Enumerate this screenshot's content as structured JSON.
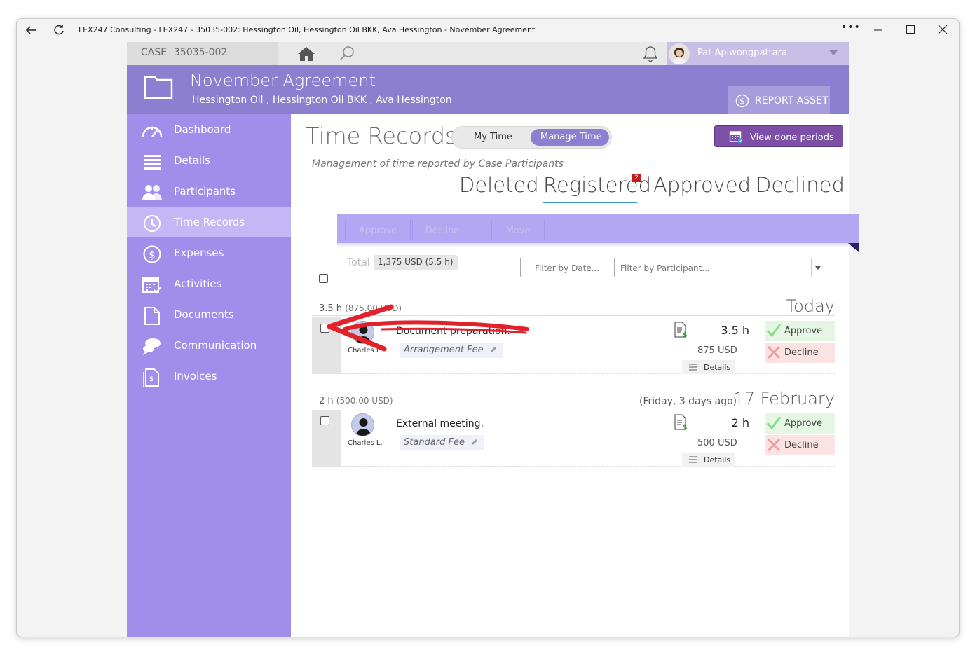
{
  "window": {
    "title": "LEX247 Consulting - LEX247 - 35035-002: Hessington Oil, Hessington Oil BKK, Ava Hessington - November Agreement",
    "more_label": "•••"
  },
  "topbar": {
    "case_label": "CASE",
    "case_number": "35035-002",
    "user_name": "Pat Apiwongpattara"
  },
  "header": {
    "title": "November Agreement",
    "subtitle": "Hessington Oil ,  Hessington Oil BKK ,  Ava Hessington",
    "report_label": "REPORT ASSET"
  },
  "sidebar": {
    "items": [
      {
        "label": "Dashboard",
        "icon": "gauge-icon"
      },
      {
        "label": "Details",
        "icon": "list-icon"
      },
      {
        "label": "Participants",
        "icon": "people-icon"
      },
      {
        "label": "Time Records",
        "icon": "clock-icon",
        "active": true
      },
      {
        "label": "Expenses",
        "icon": "dollar-circle-icon"
      },
      {
        "label": "Activities",
        "icon": "calendar-icon"
      },
      {
        "label": "Documents",
        "icon": "document-icon"
      },
      {
        "label": "Communication",
        "icon": "chat-bubble-icon"
      },
      {
        "label": "Invoices",
        "icon": "invoice-icon"
      }
    ]
  },
  "main": {
    "title": "Time Records",
    "toggle": {
      "my_time": "My Time",
      "manage_time": "Manage Time"
    },
    "view_done_label": "View done periods",
    "subtitle": "Management of time reported by Case Participants",
    "tabs": {
      "deleted": "Deleted",
      "registered": "Registered",
      "registered_badge": "2",
      "approved": "Approved",
      "declined": "Declined"
    },
    "actions": {
      "approve": "Approve",
      "decline": "Decline",
      "move": "Move"
    },
    "total_label": "Total",
    "total_value": "1,375 USD (5.5 h)",
    "filter_date_placeholder": "Filter by Date...",
    "filter_participant_placeholder": "Filter by Participant..."
  },
  "groups": [
    {
      "hours": "3.5 h",
      "amount": "(875.00 USD)",
      "relative": "",
      "date": "Today",
      "record": {
        "user": "Charles L.",
        "description": "Document preparation.",
        "fee": "Arrangement Fee",
        "hours": "3.5 h",
        "amount": "875 USD",
        "details": "Details",
        "approve": "Approve",
        "decline": "Decline"
      }
    },
    {
      "hours": "2 h",
      "amount": "(500.00 USD)",
      "relative": "(Friday, 3 days ago)",
      "date": "17 February",
      "record": {
        "user": "Charles L.",
        "description": "External meeting.",
        "fee": "Standard Fee",
        "hours": "2 h",
        "amount": "500 USD",
        "details": "Details",
        "approve": "Approve",
        "decline": "Decline"
      }
    }
  ],
  "colors": {
    "accent": "#8c7fd0",
    "sidebar": "#a08eea",
    "sidebar_active": "#c4b7f5",
    "done_button": "#7e4fa7",
    "annotation_arrow": "#e0232a"
  }
}
